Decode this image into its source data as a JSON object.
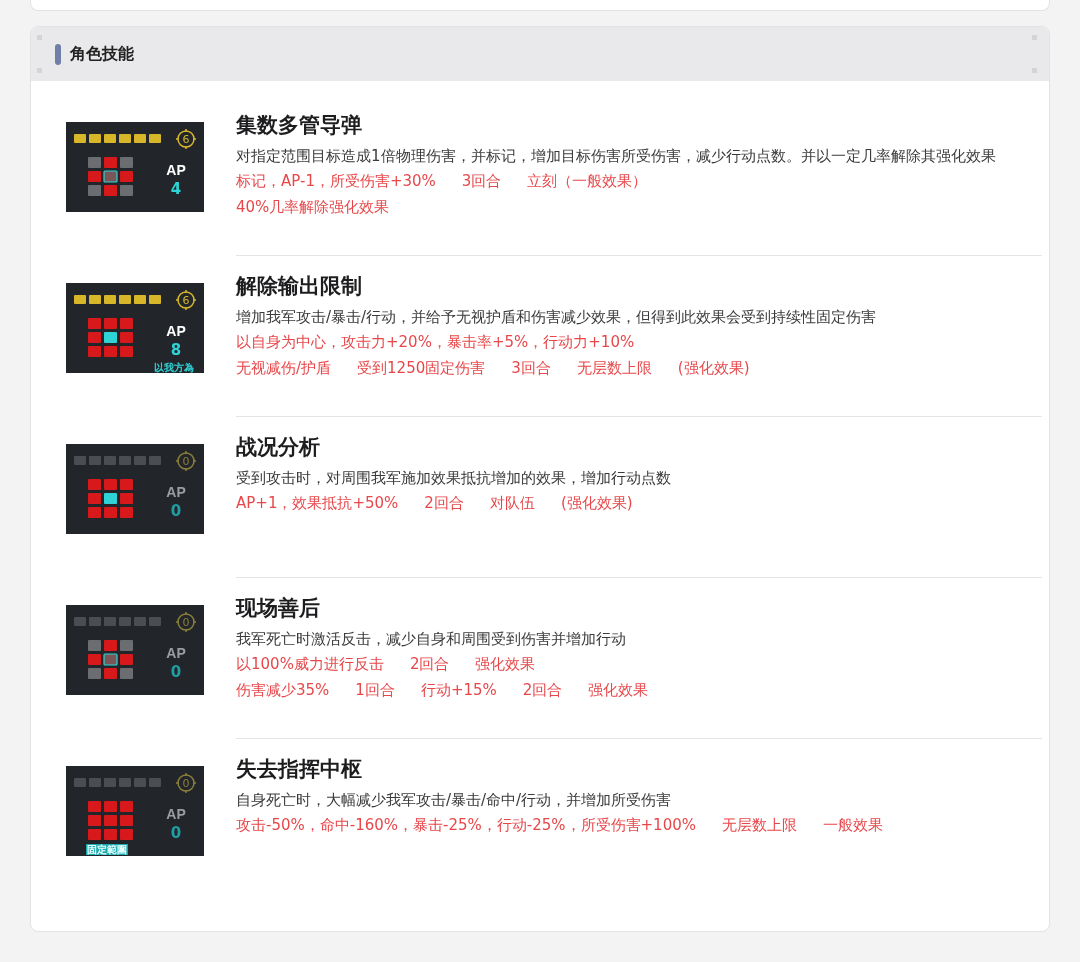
{
  "section": {
    "title": "角色技能"
  },
  "skills": [
    {
      "name": "集数多管导弹",
      "description": "对指定范围目标造成1倍物理伤害，并标记，增加目标伤害所受伤害，减少行动点数。并以一定几率解除其强化效果",
      "effects": [
        [
          "标记，AP-1，所受伤害+30%",
          "3回合",
          "立刻（一般效果）"
        ],
        [
          "40%几率解除强化效果"
        ]
      ],
      "icon": {
        "charged": true,
        "range": "6",
        "ap_label": "AP",
        "ap": "4",
        "grid": [
          {
            "kind": "off"
          },
          {
            "kind": "hit"
          },
          {
            "kind": "off"
          },
          {
            "kind": "hit"
          },
          {
            "kind": "mark"
          },
          {
            "kind": "hit"
          },
          {
            "kind": "off"
          },
          {
            "kind": "hit"
          },
          {
            "kind": "off"
          }
        ]
      }
    },
    {
      "name": "解除输出限制",
      "description": "增加我军攻击/暴击/行动，并给予无视护盾和伤害减少效果，但得到此效果会受到持续性固定伤害",
      "effects": [
        [
          "以自身为中心，攻击力+20%，暴击率+5%，行动力+10%"
        ],
        [
          "无视减伤/护盾",
          "受到1250固定伤害",
          "3回合",
          "无层数上限",
          "(强化效果)"
        ]
      ],
      "icon": {
        "charged": true,
        "range": "6",
        "ap_label": "AP",
        "ap": "8",
        "tag": "以我方為",
        "grid": [
          {
            "kind": "hit"
          },
          {
            "kind": "hit"
          },
          {
            "kind": "hit"
          },
          {
            "kind": "hit"
          },
          {
            "kind": "self"
          },
          {
            "kind": "hit"
          },
          {
            "kind": "hit"
          },
          {
            "kind": "hit"
          },
          {
            "kind": "hit"
          }
        ]
      }
    },
    {
      "name": "战况分析",
      "description": "受到攻击时，对周围我军施加效果抵抗增加的效果，增加行动点数",
      "effects": [
        [
          "AP+1，效果抵抗+50%",
          "2回合",
          "对队伍",
          "(强化效果)"
        ]
      ],
      "icon": {
        "charged": false,
        "range": "0",
        "ap_label": "AP",
        "ap": "0",
        "grid": [
          {
            "kind": "hit"
          },
          {
            "kind": "hit"
          },
          {
            "kind": "hit"
          },
          {
            "kind": "hit"
          },
          {
            "kind": "self"
          },
          {
            "kind": "hit"
          },
          {
            "kind": "hit"
          },
          {
            "kind": "hit"
          },
          {
            "kind": "hit"
          }
        ]
      }
    },
    {
      "name": "现场善后",
      "description": "我军死亡时激活反击，减少自身和周围受到伤害并增加行动",
      "effects": [
        [
          "以100%威力进行反击",
          "2回合",
          "强化效果"
        ],
        [
          "伤害减少35%",
          "1回合",
          "行动+15%",
          "2回合",
          "强化效果"
        ]
      ],
      "icon": {
        "charged": false,
        "range": "0",
        "ap_label": "AP",
        "ap": "0",
        "grid": [
          {
            "kind": "off"
          },
          {
            "kind": "hit"
          },
          {
            "kind": "off"
          },
          {
            "kind": "hit"
          },
          {
            "kind": "mark"
          },
          {
            "kind": "hit"
          },
          {
            "kind": "off"
          },
          {
            "kind": "hit"
          },
          {
            "kind": "off"
          }
        ]
      }
    },
    {
      "name": "失去指挥中枢",
      "description": "自身死亡时，大幅减少我军攻击/暴击/命中/行动，并增加所受伤害",
      "effects": [
        [
          "攻击-50%，命中-160%，暴击-25%，行动-25%，所受伤害+100%",
          "无层数上限",
          "一般效果"
        ]
      ],
      "icon": {
        "charged": false,
        "range": "0",
        "ap_label": "AP",
        "ap": "0",
        "tag": "固定範圍",
        "tag_boxed": true,
        "grid": [
          {
            "kind": "hit"
          },
          {
            "kind": "hit"
          },
          {
            "kind": "hit"
          },
          {
            "kind": "hit"
          },
          {
            "kind": "hit"
          },
          {
            "kind": "hit"
          },
          {
            "kind": "hit"
          },
          {
            "kind": "hit"
          },
          {
            "kind": "hit"
          }
        ]
      }
    }
  ]
}
